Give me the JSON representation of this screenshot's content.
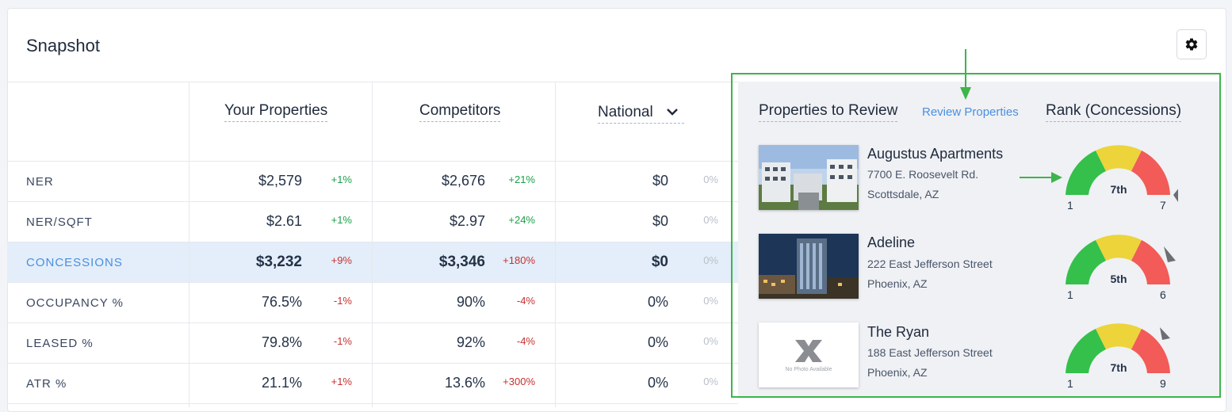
{
  "title": "Snapshot",
  "columns": [
    "Your Properties",
    "Competitors",
    "National"
  ],
  "rows": [
    {
      "label": "NER",
      "your": "$2,579",
      "your_pct": "+1%",
      "your_dir": "up",
      "comp": "$2,676",
      "comp_pct": "+21%",
      "comp_dir": "up",
      "nat": "$0",
      "nat_pct": "0%"
    },
    {
      "label": "NER/SQFT",
      "your": "$2.61",
      "your_pct": "+1%",
      "your_dir": "up",
      "comp": "$2.97",
      "comp_pct": "+24%",
      "comp_dir": "up",
      "nat": "$0",
      "nat_pct": "0%"
    },
    {
      "label": "CONCESSIONS",
      "your": "$3,232",
      "your_pct": "+9%",
      "your_dir": "down",
      "comp": "$3,346",
      "comp_pct": "+180%",
      "comp_dir": "down",
      "nat": "$0",
      "nat_pct": "0%"
    },
    {
      "label": "OCCUPANCY %",
      "your": "76.5%",
      "your_pct": "-1%",
      "your_dir": "down",
      "comp": "90%",
      "comp_pct": "-4%",
      "comp_dir": "down",
      "nat": "0%",
      "nat_pct": "0%"
    },
    {
      "label": "LEASED %",
      "your": "79.8%",
      "your_pct": "-1%",
      "your_dir": "down",
      "comp": "92%",
      "comp_pct": "-4%",
      "comp_dir": "down",
      "nat": "0%",
      "nat_pct": "0%"
    },
    {
      "label": "ATR %",
      "your": "21.1%",
      "your_pct": "+1%",
      "your_dir": "down",
      "comp": "13.6%",
      "comp_pct": "+300%",
      "comp_dir": "down",
      "nat": "0%",
      "nat_pct": "0%"
    }
  ],
  "review": {
    "heading": "Properties to Review",
    "link": "Review Properties",
    "rank_heading": "Rank (Concessions)",
    "properties": [
      {
        "name": "Augustus Apartments",
        "address1": "7700 E. Roosevelt Rd.",
        "address2": "Scottsdale, AZ",
        "rank": "7th",
        "min": "1",
        "max": "7",
        "rank_value": 7,
        "rank_total": 7,
        "photo": "building-photo"
      },
      {
        "name": "Adeline",
        "address1": "222 East Jefferson Street",
        "address2": "Phoenix, AZ",
        "rank": "5th",
        "min": "1",
        "max": "6",
        "rank_value": 5,
        "rank_total": 6,
        "photo": "night-building-photo"
      },
      {
        "name": "The Ryan",
        "address1": "188 East Jefferson Street",
        "address2": "Phoenix, AZ",
        "rank": "7th",
        "min": "1",
        "max": "9",
        "rank_value": 7,
        "rank_total": 9,
        "photo": "no-photo",
        "photo_text": "No Photo Available"
      }
    ]
  },
  "colors": {
    "accent": "#4a8fe0",
    "up": "#1aa146",
    "down": "#c8302f",
    "annotation": "#3db54a",
    "gauge_green": "#34c04b",
    "gauge_yellow": "#ecd43a",
    "gauge_red": "#f25b57"
  }
}
